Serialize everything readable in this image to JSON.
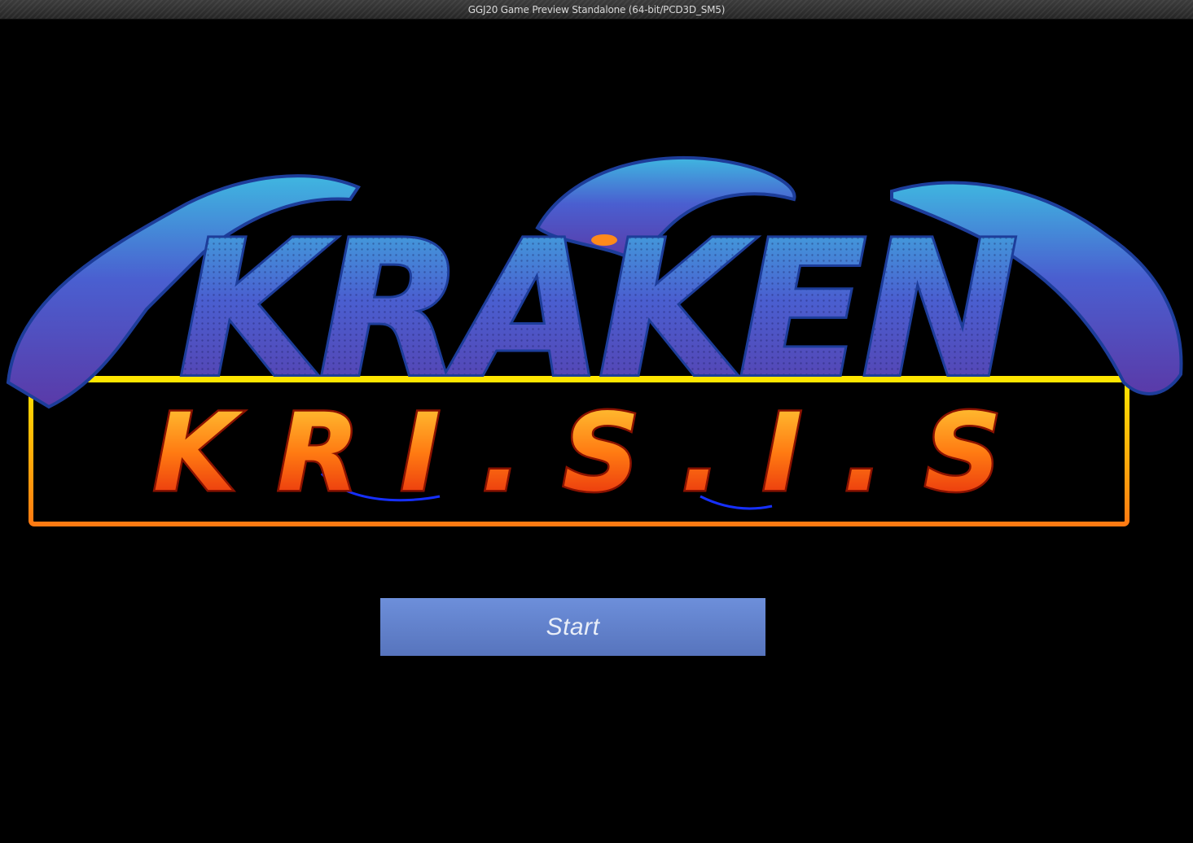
{
  "window": {
    "title": "GGJ20 Game Preview Standalone (64-bit/PCD3D_SM5)"
  },
  "logo": {
    "line1": "KRAKEN",
    "line2": "KRISIS",
    "line2_display": "K R I . S . I . S",
    "colors": {
      "kraken_top": "#3fb6e0",
      "kraken_bottom": "#5a3aa8",
      "krisis_top": "#ffd23a",
      "krisis_bottom": "#e21c0c",
      "frame": "#ff8a1a",
      "frame_top": "#ffe600"
    }
  },
  "menu": {
    "start_label": "Start",
    "button_color": "#6381cc"
  }
}
